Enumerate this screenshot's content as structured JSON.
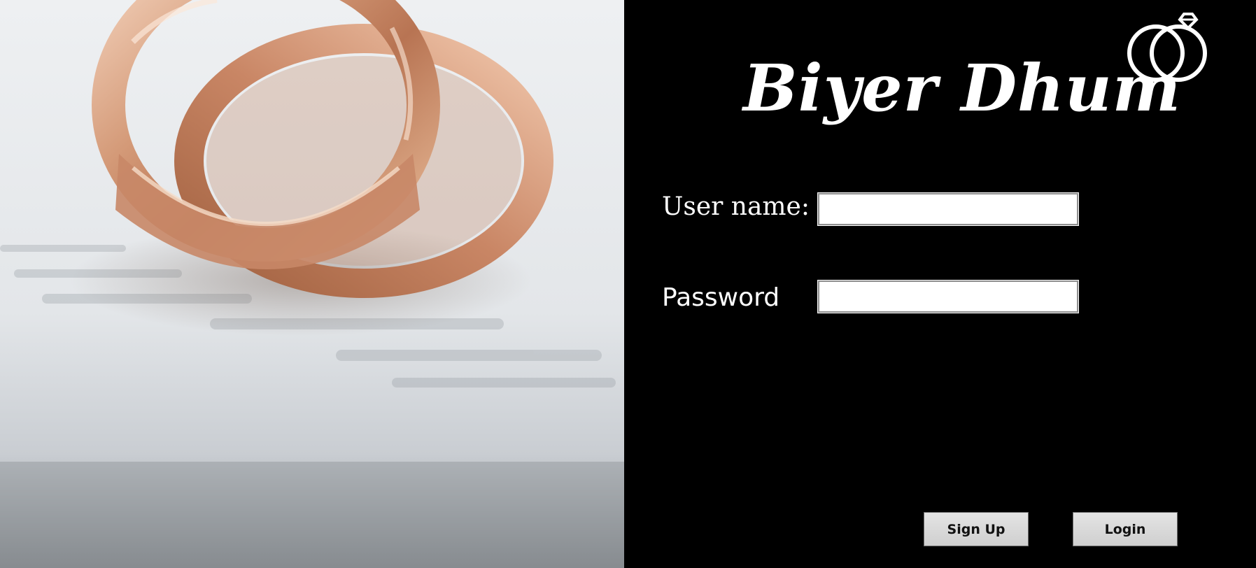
{
  "brand": {
    "name": "Biyer Dhum",
    "logo_icon": "wedding-rings-icon"
  },
  "form": {
    "username_label": "User name:",
    "username_value": "",
    "password_label": "Password",
    "password_value": ""
  },
  "buttons": {
    "signup_label": "Sign Up",
    "login_label": "Login"
  },
  "colors": {
    "panel_background": "#000000",
    "text": "#ffffff",
    "button_face": "#d6d6d6"
  }
}
